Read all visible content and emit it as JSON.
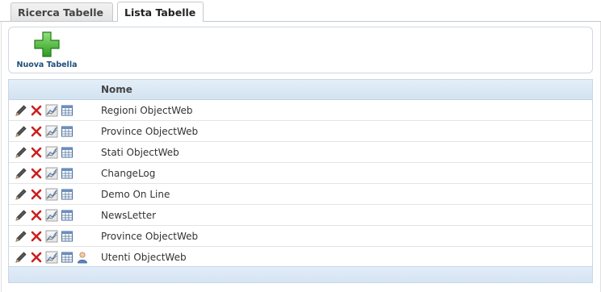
{
  "tabs": [
    {
      "label": "Ricerca Tabelle",
      "active": false
    },
    {
      "label": "Lista Tabelle",
      "active": true
    }
  ],
  "toolbar": {
    "new_label": "Nuova Tabella",
    "new_icon": "green-plus-icon"
  },
  "table": {
    "column_header": "Nome",
    "row_icons": [
      "edit-pencil-icon",
      "delete-x-icon",
      "chart-icon",
      "table-grid-icon"
    ],
    "rows": [
      {
        "name": "Regioni ObjectWeb",
        "has_user_icon": false
      },
      {
        "name": "Province ObjectWeb",
        "has_user_icon": false
      },
      {
        "name": "Stati ObjectWeb",
        "has_user_icon": false
      },
      {
        "name": "ChangeLog",
        "has_user_icon": false
      },
      {
        "name": "Demo On Line",
        "has_user_icon": false
      },
      {
        "name": "NewsLetter",
        "has_user_icon": false
      },
      {
        "name": "Province ObjectWeb",
        "has_user_icon": false
      },
      {
        "name": "Utenti ObjectWeb",
        "has_user_icon": true
      }
    ]
  },
  "colors": {
    "accent_green": "#3aa52a",
    "header_blue": "#d4e3f1",
    "link_blue": "#1f4f7a",
    "delete_red": "#cc1f1f"
  }
}
